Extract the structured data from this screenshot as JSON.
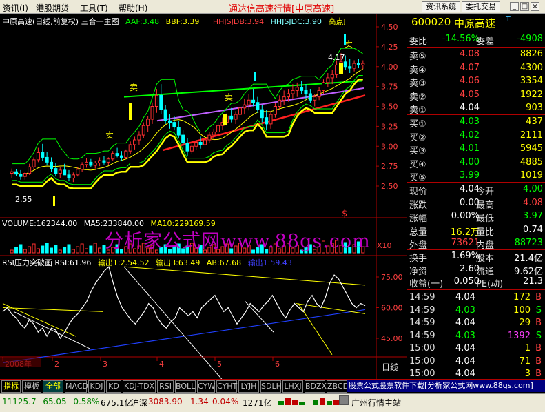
{
  "menubar": {
    "items": [
      "资讯(I)",
      "港股期货",
      "工具(T)",
      "帮助(H)"
    ],
    "title": "通达信高速行情",
    "title_tag": "[中原高速]",
    "buttons": [
      "资讯系统",
      "委托交易"
    ],
    "window_buttons": [
      "_",
      "□",
      "×"
    ]
  },
  "main_chart": {
    "title": "中原高速(日线,前复权) 三合一主图",
    "indicators": [
      {
        "text": "AAF:3.48",
        "color": "#00ff00"
      },
      {
        "text": "BBF:3.39",
        "color": "#ffff00"
      },
      {
        "text": "HHJSJDB:3.94",
        "color": "#ff4040"
      },
      {
        "text": "HHJSJDC:3.90",
        "color": "#80ffff"
      },
      {
        "text": "高点J",
        "color": "#ffff00"
      }
    ],
    "yticks": [
      "4.50",
      "4.25",
      "4.00",
      "3.75",
      "3.50",
      "3.25",
      "3.00",
      "2.75",
      "2.50"
    ],
    "labels": {
      "low": "2.55",
      "high": "4.17",
      "sell1": "卖",
      "sell2": "卖",
      "sell3": "卖",
      "sell4": "卖",
      "dollar": "$"
    },
    "candles": [
      {
        "o": 2.66,
        "h": 2.72,
        "l": 2.6,
        "c": 2.68
      },
      {
        "o": 2.68,
        "h": 2.71,
        "l": 2.63,
        "c": 2.65
      },
      {
        "o": 2.65,
        "h": 2.7,
        "l": 2.58,
        "c": 2.62
      },
      {
        "o": 2.62,
        "h": 2.68,
        "l": 2.58,
        "c": 2.66
      },
      {
        "o": 2.66,
        "h": 2.78,
        "l": 2.64,
        "c": 2.74
      },
      {
        "o": 2.74,
        "h": 2.86,
        "l": 2.7,
        "c": 2.83
      },
      {
        "o": 2.83,
        "h": 2.98,
        "l": 2.8,
        "c": 2.92
      },
      {
        "o": 2.92,
        "h": 3.03,
        "l": 2.82,
        "c": 2.86
      },
      {
        "o": 2.86,
        "h": 2.93,
        "l": 2.76,
        "c": 2.8
      },
      {
        "o": 2.8,
        "h": 2.86,
        "l": 2.68,
        "c": 2.72
      },
      {
        "o": 2.72,
        "h": 2.79,
        "l": 2.62,
        "c": 2.66
      },
      {
        "o": 2.66,
        "h": 2.74,
        "l": 2.6,
        "c": 2.7
      },
      {
        "o": 2.7,
        "h": 2.78,
        "l": 2.64,
        "c": 2.64
      },
      {
        "o": 2.64,
        "h": 2.7,
        "l": 2.56,
        "c": 2.6
      },
      {
        "o": 2.6,
        "h": 2.67,
        "l": 2.55,
        "c": 2.64
      },
      {
        "o": 2.64,
        "h": 2.74,
        "l": 2.62,
        "c": 2.71
      },
      {
        "o": 2.71,
        "h": 2.8,
        "l": 2.68,
        "c": 2.77
      },
      {
        "o": 2.77,
        "h": 2.85,
        "l": 2.73,
        "c": 2.8
      },
      {
        "o": 2.8,
        "h": 2.84,
        "l": 2.74,
        "c": 2.76
      },
      {
        "o": 2.76,
        "h": 2.82,
        "l": 2.72,
        "c": 2.79
      },
      {
        "o": 2.79,
        "h": 2.86,
        "l": 2.75,
        "c": 2.82
      },
      {
        "o": 2.82,
        "h": 2.88,
        "l": 2.77,
        "c": 2.8
      },
      {
        "o": 2.8,
        "h": 2.86,
        "l": 2.76,
        "c": 2.84
      },
      {
        "o": 2.84,
        "h": 2.94,
        "l": 2.82,
        "c": 2.91
      },
      {
        "o": 2.91,
        "h": 2.98,
        "l": 2.86,
        "c": 2.88
      },
      {
        "o": 2.88,
        "h": 2.94,
        "l": 2.82,
        "c": 2.86
      },
      {
        "o": 2.86,
        "h": 2.96,
        "l": 2.84,
        "c": 2.94
      },
      {
        "o": 2.94,
        "h": 3.06,
        "l": 2.9,
        "c": 3.02
      },
      {
        "o": 3.02,
        "h": 3.12,
        "l": 2.96,
        "c": 3.08
      },
      {
        "o": 3.08,
        "h": 3.19,
        "l": 3.02,
        "c": 3.14
      },
      {
        "o": 3.14,
        "h": 3.3,
        "l": 3.1,
        "c": 3.26
      },
      {
        "o": 3.26,
        "h": 3.38,
        "l": 3.18,
        "c": 3.34
      },
      {
        "o": 3.34,
        "h": 3.55,
        "l": 3.28,
        "c": 3.5
      },
      {
        "o": 3.5,
        "h": 3.72,
        "l": 3.42,
        "c": 3.64
      },
      {
        "o": 3.64,
        "h": 3.78,
        "l": 3.4,
        "c": 3.46
      },
      {
        "o": 3.46,
        "h": 3.52,
        "l": 3.28,
        "c": 3.32
      },
      {
        "o": 3.32,
        "h": 3.4,
        "l": 3.22,
        "c": 3.3
      },
      {
        "o": 3.3,
        "h": 3.38,
        "l": 3.2,
        "c": 3.24
      },
      {
        "o": 3.24,
        "h": 3.32,
        "l": 3.1,
        "c": 3.14
      },
      {
        "o": 3.14,
        "h": 3.2,
        "l": 2.98,
        "c": 3.04
      },
      {
        "o": 3.04,
        "h": 3.1,
        "l": 2.88,
        "c": 2.94
      },
      {
        "o": 2.94,
        "h": 3.04,
        "l": 2.9,
        "c": 3.0
      },
      {
        "o": 3.0,
        "h": 3.08,
        "l": 2.95,
        "c": 3.05
      },
      {
        "o": 3.05,
        "h": 3.12,
        "l": 2.97,
        "c": 3.02
      },
      {
        "o": 3.02,
        "h": 3.1,
        "l": 2.98,
        "c": 3.08
      },
      {
        "o": 3.08,
        "h": 3.18,
        "l": 3.04,
        "c": 3.14
      },
      {
        "o": 3.14,
        "h": 3.22,
        "l": 3.08,
        "c": 3.18
      },
      {
        "o": 3.18,
        "h": 3.3,
        "l": 3.14,
        "c": 3.26
      },
      {
        "o": 3.26,
        "h": 3.36,
        "l": 3.2,
        "c": 3.3
      },
      {
        "o": 3.3,
        "h": 3.42,
        "l": 3.26,
        "c": 3.38
      },
      {
        "o": 3.38,
        "h": 3.48,
        "l": 3.3,
        "c": 3.34
      },
      {
        "o": 3.34,
        "h": 3.44,
        "l": 3.28,
        "c": 3.4
      },
      {
        "o": 3.4,
        "h": 3.52,
        "l": 3.36,
        "c": 3.48
      },
      {
        "o": 3.48,
        "h": 3.6,
        "l": 3.4,
        "c": 3.52
      },
      {
        "o": 3.52,
        "h": 3.66,
        "l": 3.45,
        "c": 3.58
      },
      {
        "o": 3.58,
        "h": 3.72,
        "l": 3.5,
        "c": 3.55
      },
      {
        "o": 3.55,
        "h": 3.62,
        "l": 3.42,
        "c": 3.46
      },
      {
        "o": 3.46,
        "h": 3.52,
        "l": 3.3,
        "c": 3.36
      },
      {
        "o": 3.36,
        "h": 3.46,
        "l": 3.2,
        "c": 3.28
      },
      {
        "o": 3.28,
        "h": 3.44,
        "l": 3.22,
        "c": 3.4
      },
      {
        "o": 3.4,
        "h": 3.54,
        "l": 3.36,
        "c": 3.5
      },
      {
        "o": 3.5,
        "h": 3.64,
        "l": 3.46,
        "c": 3.58
      },
      {
        "o": 3.58,
        "h": 3.7,
        "l": 3.52,
        "c": 3.62
      },
      {
        "o": 3.62,
        "h": 3.72,
        "l": 3.56,
        "c": 3.66
      },
      {
        "o": 3.66,
        "h": 3.78,
        "l": 3.6,
        "c": 3.7
      },
      {
        "o": 3.7,
        "h": 3.8,
        "l": 3.62,
        "c": 3.74
      },
      {
        "o": 3.74,
        "h": 3.82,
        "l": 3.66,
        "c": 3.7
      },
      {
        "o": 3.7,
        "h": 3.78,
        "l": 3.6,
        "c": 3.66
      },
      {
        "o": 3.66,
        "h": 3.72,
        "l": 3.54,
        "c": 3.58
      },
      {
        "o": 3.58,
        "h": 3.66,
        "l": 3.5,
        "c": 3.62
      },
      {
        "o": 3.62,
        "h": 3.74,
        "l": 3.58,
        "c": 3.7
      },
      {
        "o": 3.7,
        "h": 3.84,
        "l": 3.66,
        "c": 3.8
      },
      {
        "o": 3.8,
        "h": 3.92,
        "l": 3.74,
        "c": 3.86
      },
      {
        "o": 3.86,
        "h": 3.96,
        "l": 3.78,
        "c": 3.9
      },
      {
        "o": 3.9,
        "h": 4.08,
        "l": 3.86,
        "c": 4.02
      },
      {
        "o": 4.02,
        "h": 4.17,
        "l": 3.94,
        "c": 4.06
      },
      {
        "o": 4.06,
        "h": 4.14,
        "l": 3.96,
        "c": 4.0
      },
      {
        "o": 4.0,
        "h": 4.1,
        "l": 3.92,
        "c": 3.98
      },
      {
        "o": 3.98,
        "h": 4.08,
        "l": 3.94,
        "c": 4.04
      },
      {
        "o": 4.04,
        "h": 4.1,
        "l": 3.98,
        "c": 4.02
      },
      {
        "o": 4.02,
        "h": 4.08,
        "l": 3.97,
        "c": 4.04
      }
    ]
  },
  "volume": {
    "legend": [
      {
        "text": "VOLUME:162344.00",
        "color": "#ffffff"
      },
      {
        "text": "MA5:233840.00",
        "color": "#ffffff"
      },
      {
        "text": "MA10:229169.59",
        "color": "#ffff00"
      }
    ],
    "scale_label": "X10",
    "watermark": "分析家公式网www.88gs.com"
  },
  "rsi": {
    "legend": [
      {
        "text": "RSI压力突破画 RSI:61.96",
        "color": "#ffffff"
      },
      {
        "text": "输出1:2.54.52",
        "color": "#ffff00"
      },
      {
        "text": "输出3:63.49",
        "color": "#ffff00"
      },
      {
        "text": "AB:67.68",
        "color": "#ffff00"
      },
      {
        "text": "输出1:59.43",
        "color": "#4040ff"
      }
    ],
    "yticks": [
      "75.00",
      "60.00",
      "45.00"
    ],
    "values": [
      58,
      60,
      57,
      55,
      52,
      50,
      54,
      52,
      48,
      50,
      46,
      50,
      49,
      45,
      48,
      52,
      55,
      57,
      60,
      63,
      68,
      72,
      75,
      78,
      80,
      72,
      65,
      60,
      57,
      54,
      52,
      55,
      58,
      62,
      60,
      55,
      52,
      50,
      53,
      55,
      60,
      58,
      56,
      58,
      55,
      60,
      62,
      64,
      66,
      62,
      58,
      60,
      56,
      52,
      55,
      58,
      62,
      60,
      58,
      61,
      63,
      66,
      62,
      58,
      55,
      59,
      62,
      60,
      58,
      63,
      66,
      62,
      60,
      65,
      72,
      76,
      74,
      70,
      66,
      62,
      60,
      62,
      61
    ]
  },
  "xaxis": {
    "labels": [
      "2008年",
      "2",
      "3",
      "4",
      "5",
      "6"
    ],
    "period": "日线"
  },
  "quote": {
    "code": "600020",
    "name": "中原高速",
    "flag": "T",
    "weibi_label": "委比",
    "weibi": "-14.56%",
    "weicha_label": "委差",
    "weicha": "-4908",
    "sells": [
      {
        "label": "卖⑤",
        "price": "4.08",
        "vol": "8826"
      },
      {
        "label": "卖④",
        "price": "4.07",
        "vol": "4300"
      },
      {
        "label": "卖③",
        "price": "4.06",
        "vol": "3354"
      },
      {
        "label": "卖②",
        "price": "4.05",
        "vol": "1922"
      },
      {
        "label": "卖①",
        "price": "4.04",
        "vol": "903"
      }
    ],
    "buys": [
      {
        "label": "买①",
        "price": "4.03",
        "vol": "437"
      },
      {
        "label": "买②",
        "price": "4.02",
        "vol": "2111"
      },
      {
        "label": "买③",
        "price": "4.01",
        "vol": "5945"
      },
      {
        "label": "买④",
        "price": "4.00",
        "vol": "4885"
      },
      {
        "label": "买⑤",
        "price": "3.99",
        "vol": "1019"
      }
    ],
    "stats": [
      {
        "l1": "现价",
        "v1": "4.04",
        "c1": "#ffffff",
        "l2": "今开",
        "v2": "4.00",
        "c2": "#00ff00"
      },
      {
        "l1": "涨跌",
        "v1": "0.00",
        "c1": "#ffffff",
        "l2": "最高",
        "v2": "4.08",
        "c2": "#ff4040"
      },
      {
        "l1": "涨幅",
        "v1": "0.00%",
        "c1": "#ffffff",
        "l2": "最低",
        "v2": "3.97",
        "c2": "#00ff00"
      },
      {
        "l1": "总量",
        "v1": "16.2万",
        "c1": "#ffff00",
        "l2": "量比",
        "v2": "0.74",
        "c2": "#ffffff"
      },
      {
        "l1": "外盘",
        "v1": "73621",
        "c1": "#ff4040",
        "l2": "内盘",
        "v2": "88723",
        "c2": "#00ff00"
      }
    ],
    "stats2": [
      {
        "l1": "换手",
        "v1": "1.69%",
        "l2": "股本",
        "v2": "21.4亿"
      },
      {
        "l1": "净资",
        "v1": "2.60",
        "l2": "流通",
        "v2": "9.62亿"
      },
      {
        "l1": "收益(一)",
        "v1": "0.050",
        "l2": "PE(动)",
        "v2": "21.3"
      }
    ],
    "trades": [
      {
        "t": "14:59",
        "p": "4.04",
        "pc": "#ffffff",
        "q": "172",
        "d": "B",
        "dc": "#ff4040"
      },
      {
        "t": "14:59",
        "p": "4.03",
        "pc": "#00ff00",
        "q": "100",
        "d": "S",
        "dc": "#00ff00"
      },
      {
        "t": "14:59",
        "p": "4.04",
        "pc": "#ffffff",
        "q": "29",
        "d": "B",
        "dc": "#ff4040"
      },
      {
        "t": "14:59",
        "p": "4.03",
        "pc": "#00ff00",
        "q": "1392",
        "d": "S",
        "dc": "#00ff00",
        "qc": "#ff40ff"
      },
      {
        "t": "15:00",
        "p": "4.04",
        "pc": "#ffffff",
        "q": "1",
        "d": "B",
        "dc": "#ff4040"
      },
      {
        "t": "15:00",
        "p": "4.04",
        "pc": "#ffffff",
        "q": "71",
        "d": "B",
        "dc": "#ff4040"
      },
      {
        "t": "15:00",
        "p": "4.04",
        "pc": "#ffffff",
        "q": "3",
        "d": "B",
        "dc": "#ff4040"
      }
    ]
  },
  "tabs": [
    "指标",
    "模板",
    "全部",
    "MACD",
    "KDJ",
    "KD",
    "KDJ-TDX",
    "RSI",
    "BOLL",
    "CYW",
    "CYHT",
    "LYJH",
    "SDLH",
    "LHXJ",
    "BDZX",
    "ZBCD"
  ],
  "promo": "股票公式股票软件下载[分析家公式网www.88gs.com]",
  "status": {
    "index": "11125.7",
    "change": "-65.05",
    "pct": "-0.58%",
    "amount": "675.1亿",
    "sz_label": "沪深",
    "sz_index": "3083.90",
    "sz_change": "1.34",
    "sz_pct": "0.04%",
    "sz_amount": "1271亿",
    "server": "广州行情主站"
  }
}
